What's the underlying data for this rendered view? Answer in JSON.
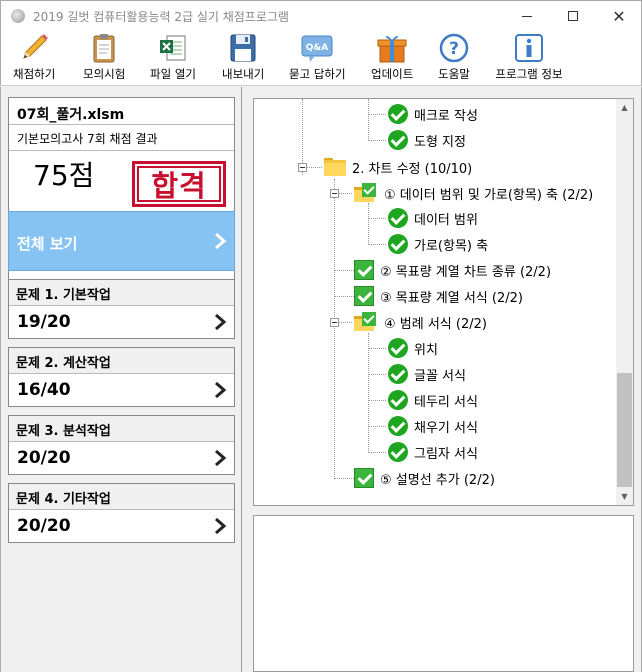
{
  "window": {
    "title": "2019 길벗 컴퓨터활용능력 2급 실기 채점프로그램",
    "minimize": "—",
    "maximize": "□",
    "close": "✕"
  },
  "toolbar": {
    "items": [
      {
        "label": "채점하기",
        "icon": "pencil-icon"
      },
      {
        "label": "모의시험",
        "icon": "clipboard-icon"
      },
      {
        "label": "파일 열기",
        "icon": "excel-file-icon"
      },
      {
        "label": "내보내기",
        "icon": "floppy-disk-icon"
      },
      {
        "label": "묻고 답하기",
        "icon": "qa-bubble-icon"
      },
      {
        "label": "업데이트",
        "icon": "gift-icon"
      },
      {
        "label": "도움말",
        "icon": "question-icon"
      },
      {
        "label": "프로그램 정보",
        "icon": "info-icon"
      }
    ],
    "qa_icon_text": "Q&A"
  },
  "result": {
    "file_name": "07회_풀거.xlsm",
    "description": "기본모의고사 7회 채점 결과",
    "score": "75점",
    "stamp": "합격"
  },
  "view_all": {
    "label": "전체 보기"
  },
  "problems": [
    {
      "title": "문제 1. 기본작업",
      "score": "19/20"
    },
    {
      "title": "문제 2. 계산작업",
      "score": "16/40"
    },
    {
      "title": "문제 3. 분석작업",
      "score": "20/20"
    },
    {
      "title": "문제 4. 기타작업",
      "score": "20/20"
    }
  ],
  "tree": {
    "items": [
      {
        "label": "매크로 작성",
        "type": "check"
      },
      {
        "label": "도형 지정",
        "type": "check"
      },
      {
        "label": "2. 차트 수정 (10/10)",
        "type": "folder"
      },
      {
        "label": "① 데이터 범위 및 가로(항목) 축 (2/2)",
        "type": "folder-check"
      },
      {
        "label": "데이터 범위",
        "type": "check"
      },
      {
        "label": "가로(항목) 축",
        "type": "check"
      },
      {
        "label": "② 목표량 계열 차트 종류 (2/2)",
        "type": "square"
      },
      {
        "label": "③ 목표량 계열 서식 (2/2)",
        "type": "square"
      },
      {
        "label": "④ 범례 서식 (2/2)",
        "type": "folder-check"
      },
      {
        "label": "위치",
        "type": "check"
      },
      {
        "label": "글꼴 서식",
        "type": "check"
      },
      {
        "label": "테두리 서식",
        "type": "check"
      },
      {
        "label": "채우기 서식",
        "type": "check"
      },
      {
        "label": "그림자 서식",
        "type": "check"
      },
      {
        "label": "⑤ 설명선 추가 (2/2)",
        "type": "square"
      }
    ]
  },
  "scrollbar": {
    "up": "▲",
    "down": "▼"
  },
  "colors": {
    "view_all_bg": "#87c3f2",
    "check_green": "#1fa51f",
    "stamp_red": "#c8102e",
    "folder_yellow": "#ffd75c"
  }
}
